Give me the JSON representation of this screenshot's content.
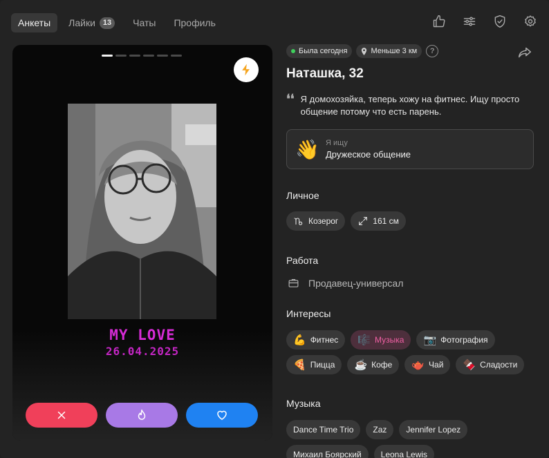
{
  "nav": {
    "tabs": [
      {
        "label": "Анкеты"
      },
      {
        "label": "Лайки",
        "badge": "13"
      },
      {
        "label": "Чаты"
      },
      {
        "label": "Профиль"
      }
    ],
    "icons": [
      "thumb-up-icon",
      "filters-icon",
      "shield-check-icon",
      "gear-icon"
    ]
  },
  "card": {
    "photo_count": 6,
    "active_photo": 1,
    "caption_line1": "MY LOVE",
    "caption_line2": "26.04.2025",
    "boost_icon": "lightning-icon",
    "actions": [
      "close-icon",
      "flame-icon",
      "heart-icon"
    ],
    "colors": {
      "dislike": "#f0405a",
      "superlike": "#a879e6",
      "like": "#1f82f2",
      "caption": "#d62bd6"
    }
  },
  "profile": {
    "status": "Была сегодня",
    "distance": "Меньше 3 км",
    "help": "?",
    "name": "Наташка, 32",
    "bio": "Я домохозяйка, теперь хожу на фитнес. Ищу просто общение потому что есть парень.",
    "seek_emoji": "👋",
    "seek_label": "Я ищу",
    "seek_value": "Дружеское общение"
  },
  "personal": {
    "title": "Личное",
    "items": [
      {
        "icon": "capricorn-icon",
        "label": "Козерог"
      },
      {
        "icon": "height-icon",
        "label": "161 см"
      }
    ]
  },
  "work": {
    "title": "Работа",
    "value": "Продавец-универсал"
  },
  "interests": {
    "title": "Интересы",
    "items": [
      {
        "emoji": "💪",
        "label": "Фитнес"
      },
      {
        "emoji": "🎼",
        "label": "Музыка",
        "highlighted": true
      },
      {
        "emoji": "📷",
        "label": "Фотография"
      },
      {
        "emoji": "🍕",
        "label": "Пицца"
      },
      {
        "emoji": "☕",
        "label": "Кофе"
      },
      {
        "emoji": "🫖",
        "label": "Чай"
      },
      {
        "emoji": "🍫",
        "label": "Сладости"
      }
    ]
  },
  "music": {
    "title": "Музыка",
    "artists": [
      "Dance Time Trio",
      "Zaz",
      "Jennifer Lopez",
      "Михаил Боярский",
      "Leona Lewis"
    ]
  }
}
